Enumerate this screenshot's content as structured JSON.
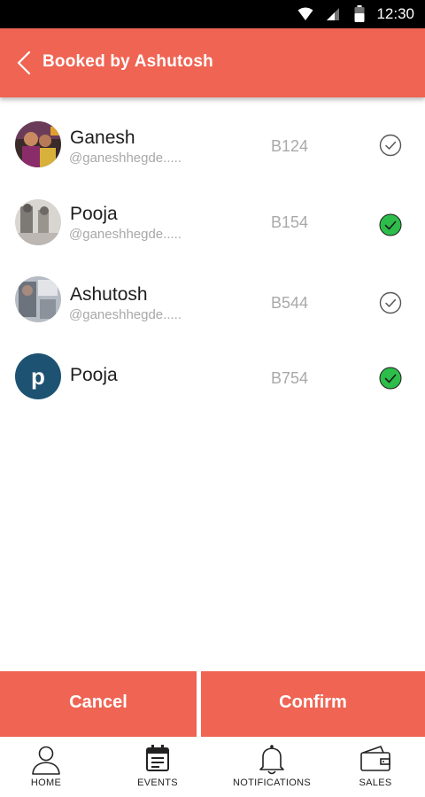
{
  "status_bar": {
    "time": "12:30",
    "icons": [
      "wifi-icon",
      "signal-icon",
      "battery-icon"
    ]
  },
  "header": {
    "title": "Booked by Ashutosh",
    "back_icon": "chevron-left-icon",
    "color": "#ef6453"
  },
  "bookings": [
    {
      "name": "Ganesh",
      "handle": "@ganeshhegde.....",
      "code": "B124",
      "confirmed": false,
      "avatar": "photo"
    },
    {
      "name": "Pooja",
      "handle": "@ganeshhegde.....",
      "code": "B154",
      "confirmed": true,
      "avatar": "photo"
    },
    {
      "name": "Ashutosh",
      "handle": "@ganeshhegde.....",
      "code": "B544",
      "confirmed": false,
      "avatar": "photo"
    },
    {
      "name": "Pooja",
      "handle": "",
      "code": "B754",
      "confirmed": true,
      "avatar": "p"
    }
  ],
  "actions": {
    "cancel": "Cancel",
    "confirm": "Confirm"
  },
  "nav": [
    {
      "label": "HOME",
      "icon": "person-icon"
    },
    {
      "label": "EVENTS",
      "icon": "calendar-icon"
    },
    {
      "label": "NOTIFICATIONS",
      "icon": "bell-icon"
    },
    {
      "label": "SALES",
      "icon": "wallet-icon"
    }
  ],
  "colors": {
    "accent": "#ef6453",
    "check_green": "#2dbd4a",
    "avatar_blue": "#1d5272"
  }
}
